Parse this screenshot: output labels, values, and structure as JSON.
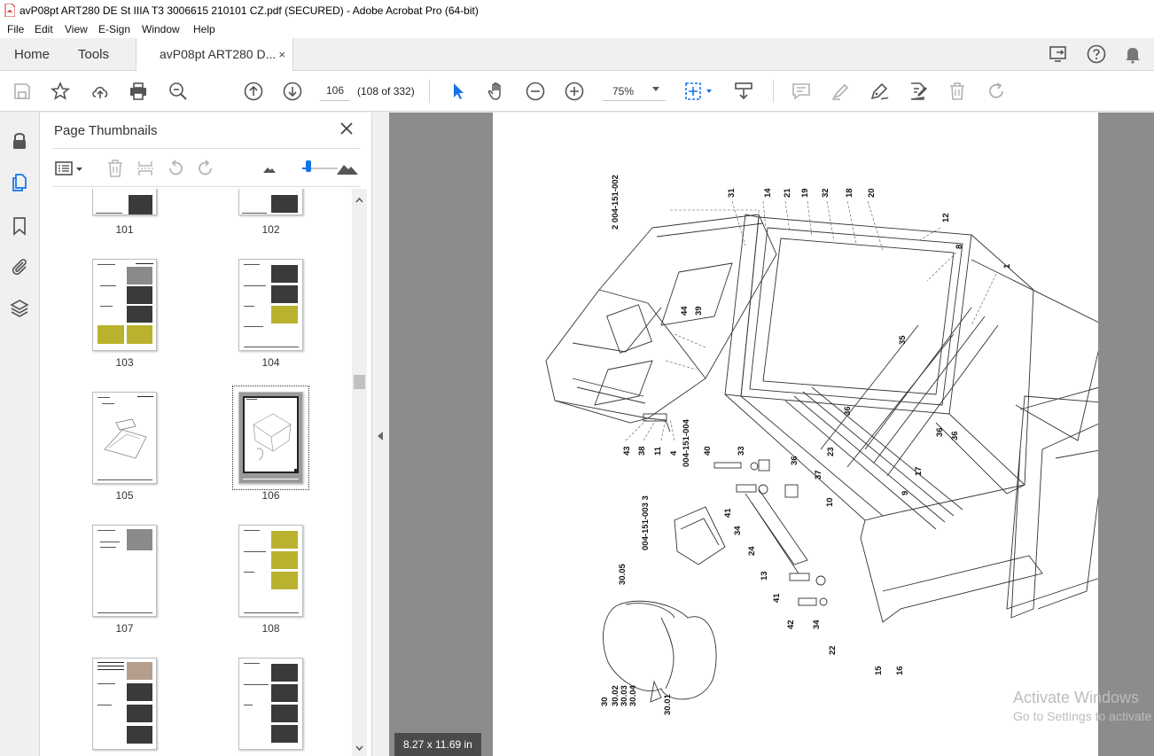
{
  "window": {
    "title": "avP08pt ART280 DE St IIIA T3 3006615 210101 CZ.pdf (SECURED) - Adobe Acrobat Pro (64-bit)",
    "accent_color": "#1473e6",
    "brand_color": "#e2231a"
  },
  "menu": [
    "File",
    "Edit",
    "View",
    "E-Sign",
    "Window",
    "Help"
  ],
  "tabs": {
    "home": "Home",
    "tools": "Tools",
    "document": "avP08pt ART280 D...",
    "close": "×"
  },
  "toolbar": {
    "current_page": "106",
    "page_count": "(108 of 332)",
    "zoom": "75%"
  },
  "thumbnails_panel": {
    "title": "Page Thumbnails",
    "close": "✕",
    "pages": [
      {
        "label": "101",
        "selected": false
      },
      {
        "label": "102",
        "selected": false
      },
      {
        "label": "103",
        "selected": false
      },
      {
        "label": "104",
        "selected": false
      },
      {
        "label": "105",
        "selected": false
      },
      {
        "label": "106",
        "selected": true
      },
      {
        "label": "107",
        "selected": false
      },
      {
        "label": "108",
        "selected": false
      },
      {
        "label": "",
        "selected": false
      },
      {
        "label": "",
        "selected": false
      }
    ]
  },
  "document": {
    "page_size": "8.27 x 11.69 in",
    "part_groups": [
      "2 004-151-002",
      "004-151-004",
      "004-151-003  3"
    ],
    "callouts": [
      "31",
      "14",
      "21",
      "19",
      "32",
      "18",
      "20",
      "12",
      "8",
      "1",
      "44",
      "39",
      "35",
      "36",
      "36",
      "23",
      "37",
      "10",
      "9",
      "17",
      "36",
      "43",
      "38",
      "11",
      "4",
      "33",
      "40",
      "41",
      "34",
      "24",
      "13",
      "41",
      "42",
      "34",
      "22",
      "15",
      "16",
      "30.05",
      "30",
      "30.02",
      "30.03",
      "30.04",
      "30.01",
      "36"
    ]
  },
  "watermark": {
    "line1": "Activate Windows",
    "line2": "Go to Settings to activate Windows."
  }
}
